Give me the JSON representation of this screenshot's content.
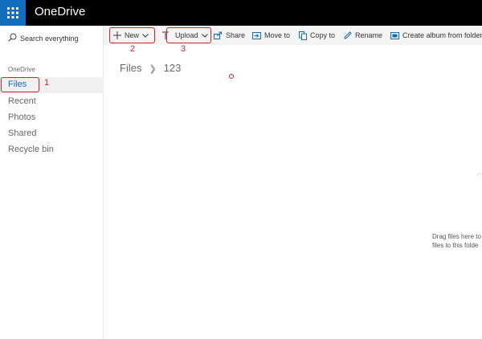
{
  "app": {
    "title": "OneDrive"
  },
  "search": {
    "placeholder": "Search everything"
  },
  "sidebar": {
    "section": "OneDrive",
    "items": [
      {
        "label": "Files",
        "active": true
      },
      {
        "label": "Recent"
      },
      {
        "label": "Photos"
      },
      {
        "label": "Shared"
      },
      {
        "label": "Recycle bin"
      }
    ]
  },
  "toolbar": {
    "new_label": "New",
    "upload_label": "Upload",
    "share_label": "Share",
    "move_label": "Move to",
    "copy_label": "Copy to",
    "rename_label": "Rename",
    "album_label": "Create album from folder"
  },
  "breadcrumb": {
    "root": "Files",
    "current": "123"
  },
  "empty_state": {
    "line1": "Drag files here to",
    "line2": "files to this folde"
  },
  "annotations": {
    "one": "1",
    "two": "2",
    "three": "3"
  },
  "colors": {
    "brand": "#0f6cbd",
    "annotation": "#d81e2a",
    "topbar": "#000000"
  }
}
